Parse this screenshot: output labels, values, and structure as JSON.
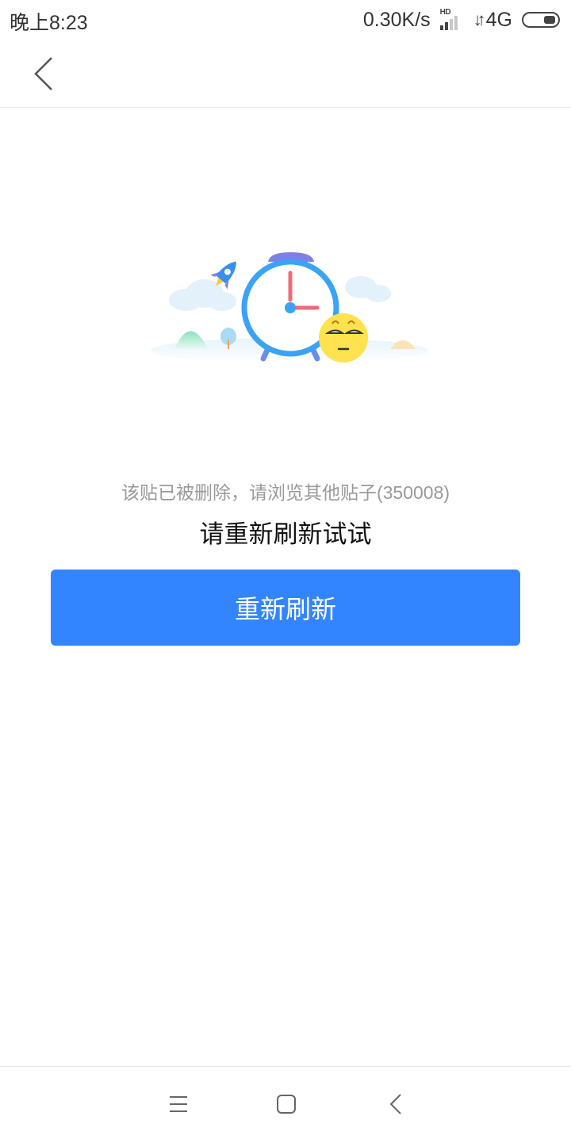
{
  "status_bar": {
    "time": "晚上8:23",
    "net_speed": "0.30K/s",
    "hd_label": "HD",
    "network_type": "4G"
  },
  "header": {
    "back_icon": "chevron-left-icon"
  },
  "content": {
    "error_message": "该贴已被删除，请浏览其他贴子(350008)",
    "hint": "请重新刷新试试",
    "refresh_label": "重新刷新"
  },
  "colors": {
    "accent": "#3385ff",
    "clock_ring": "#3aa3f5",
    "hand": "#f26b7a",
    "emoji": "#ffe24d"
  },
  "nav_bar": {
    "icons": [
      "menu-icon",
      "home-icon",
      "back-icon"
    ]
  }
}
